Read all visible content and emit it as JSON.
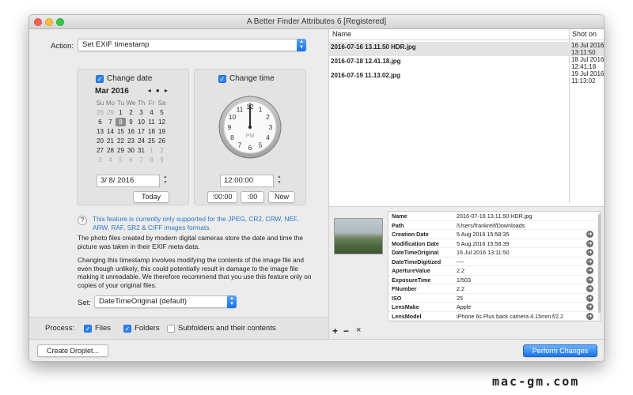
{
  "window": {
    "title": "A Better Finder Attributes 6 [Registered]"
  },
  "action": {
    "label": "Action:",
    "value": "Set EXIF timestamp"
  },
  "date_box": {
    "checkbox_label": "Change date",
    "month_label": "Mar 2016",
    "nav": "◂ ● ▸",
    "weekdays": [
      "Su",
      "Mo",
      "Tu",
      "We",
      "Th",
      "Fr",
      "Sa"
    ],
    "weeks": [
      [
        "28",
        "29",
        "1",
        "2",
        "3",
        "4",
        "5"
      ],
      [
        "6",
        "7",
        "8",
        "9",
        "10",
        "11",
        "12"
      ],
      [
        "13",
        "14",
        "15",
        "16",
        "17",
        "18",
        "19"
      ],
      [
        "20",
        "21",
        "22",
        "23",
        "24",
        "25",
        "26"
      ],
      [
        "27",
        "28",
        "29",
        "30",
        "31",
        "1",
        "2"
      ],
      [
        "3",
        "4",
        "5",
        "6",
        "7",
        "8",
        "9"
      ]
    ],
    "date_value": "3/  8/ 2016",
    "today_button": "Today"
  },
  "time_box": {
    "checkbox_label": "Change time",
    "clock_numbers": [
      "12",
      "1",
      "2",
      "3",
      "4",
      "5",
      "6",
      "7",
      "8",
      "9",
      "10",
      "11"
    ],
    "clock_period": "PM",
    "time_value": "12:00:00",
    "btn_minutes": ":00:00",
    "btn_seconds": ":00",
    "btn_now": "Now"
  },
  "info": {
    "help_icon": "?",
    "note": "This feature is currently only supported for the JPEG, CR2, CRW, NEF, ARW, RAF, SR2 & CIFF images formats.",
    "para1": "The photo files created by modern digital cameras store the date and time the picture was taken in their EXIF meta-data.",
    "para2": "Changing this timestamp involves modifying the contents of the image file and even though unlikely, this could potentially result in damage to the image file making it unreadable. We therefore recommend that you use this feature only on copies of your original files."
  },
  "set": {
    "label": "Set:",
    "value": "DateTimeOriginal (default)"
  },
  "process": {
    "label": "Process:",
    "files": "Files",
    "folders": "Folders",
    "subfolders": "Subfolders and their contents"
  },
  "file_table": {
    "col_name": "Name",
    "col_shot": "Shot on",
    "rows": [
      {
        "name": "2016-07-16 13.11.50 HDR.jpg",
        "shot1": "16 Jul 2016",
        "shot2": "13:11:50"
      },
      {
        "name": "2016-07-18 12.41.18.jpg",
        "shot1": "18 Jul 2016",
        "shot2": "12:41:18"
      },
      {
        "name": "2016-07-19 11.13.02.jpg",
        "shot1": "19 Jul 2016",
        "shot2": "11:13:02"
      }
    ]
  },
  "metadata": {
    "rows": [
      {
        "k": "Name",
        "v": "2016-07-16 13.11.50 HDR.jpg"
      },
      {
        "k": "Path",
        "v": "/Users/frankreif/Downloads"
      },
      {
        "k": "Creation Date",
        "v": "5 Aug 2016 15:58:35"
      },
      {
        "k": "Modification Date",
        "v": "5 Aug 2016 15:58:39"
      },
      {
        "k": "DateTimeOriginal",
        "v": "16 Jul 2016 13:11:50"
      },
      {
        "k": "DateTimeDigitized",
        "v": "----"
      },
      {
        "k": "ApertureValue",
        "v": "2.2"
      },
      {
        "k": "ExposureTime",
        "v": "1/503"
      },
      {
        "k": "FNumber",
        "v": "2.2"
      },
      {
        "k": "ISO",
        "v": "25"
      },
      {
        "k": "LensMake",
        "v": "Apple"
      },
      {
        "k": "LensModel",
        "v": "iPhone 6s Plus back camera 4.15mm f/2.2"
      }
    ],
    "go_icon": "➜"
  },
  "list_controls": {
    "add": "+",
    "remove": "−",
    "clear": "×"
  },
  "buttons": {
    "create_droplet": "Create Droplet...",
    "perform": "Perform Changes"
  },
  "watermark": "mac-gm.com",
  "colors": {
    "accent": "#2f83f0",
    "note_text": "#2a78c9"
  }
}
